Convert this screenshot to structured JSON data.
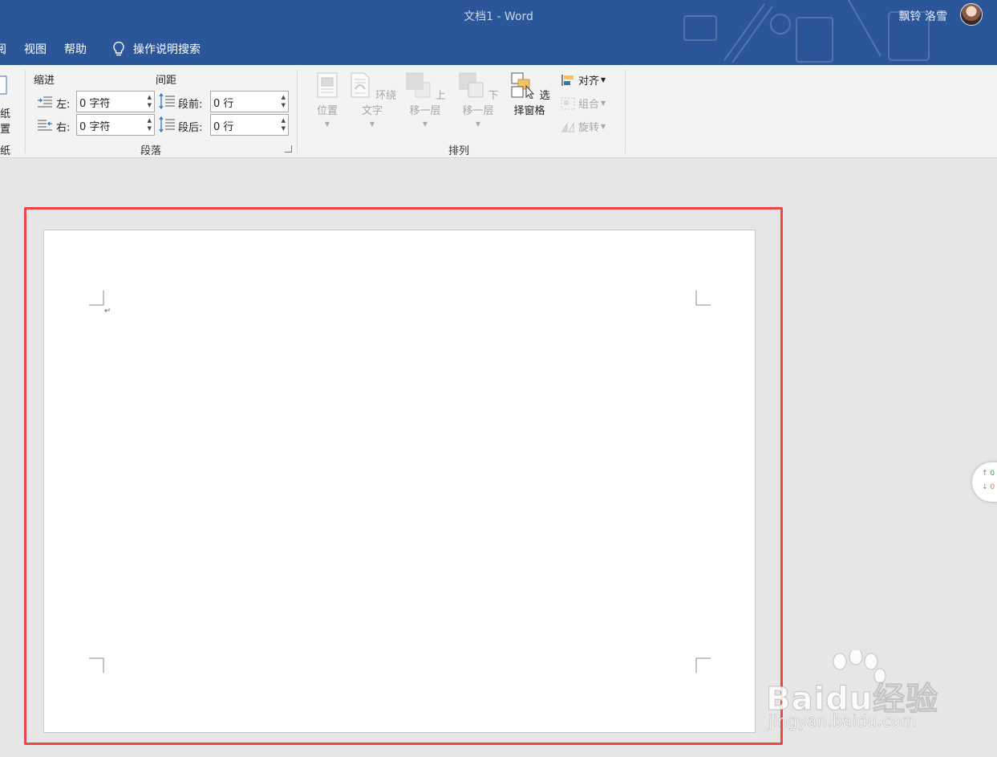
{
  "window": {
    "title": "文档1  -  Word",
    "user": "飘铃 洛雪"
  },
  "tabs": {
    "partial": "阅",
    "view": "视图",
    "help": "帮助"
  },
  "tell_me": "操作说明搜索",
  "page_setup_partial": {
    "line1": "纸",
    "line2": "置",
    "group": "纸"
  },
  "paragraph": {
    "indent_label": "缩进",
    "spacing_label": "间距",
    "left_label": "左:",
    "left_value": "0 字符",
    "right_label": "右:",
    "right_value": "0 字符",
    "before_label": "段前:",
    "before_value": "0 行",
    "after_label": "段后:",
    "after_value": "0 行",
    "group": "段落"
  },
  "arrange": {
    "position": "位置",
    "wrap_text": "环绕文字",
    "bring_forward": "上移一层",
    "send_backward": "下移一层",
    "selection_pane": "选择窗格",
    "align": "对齐",
    "group_btn": "组合",
    "rotate": "旋转",
    "group": "排列"
  },
  "speed_widget": {
    "up": "0",
    "down": "0"
  },
  "watermark": {
    "brand": "Baidu经验",
    "url": "jingyan.baidu.com"
  },
  "colors": {
    "titlebar": "#2b579a",
    "ribbon": "#f3f3f3",
    "highlight": "#e8474b",
    "canvas": "#e6e6e6"
  }
}
